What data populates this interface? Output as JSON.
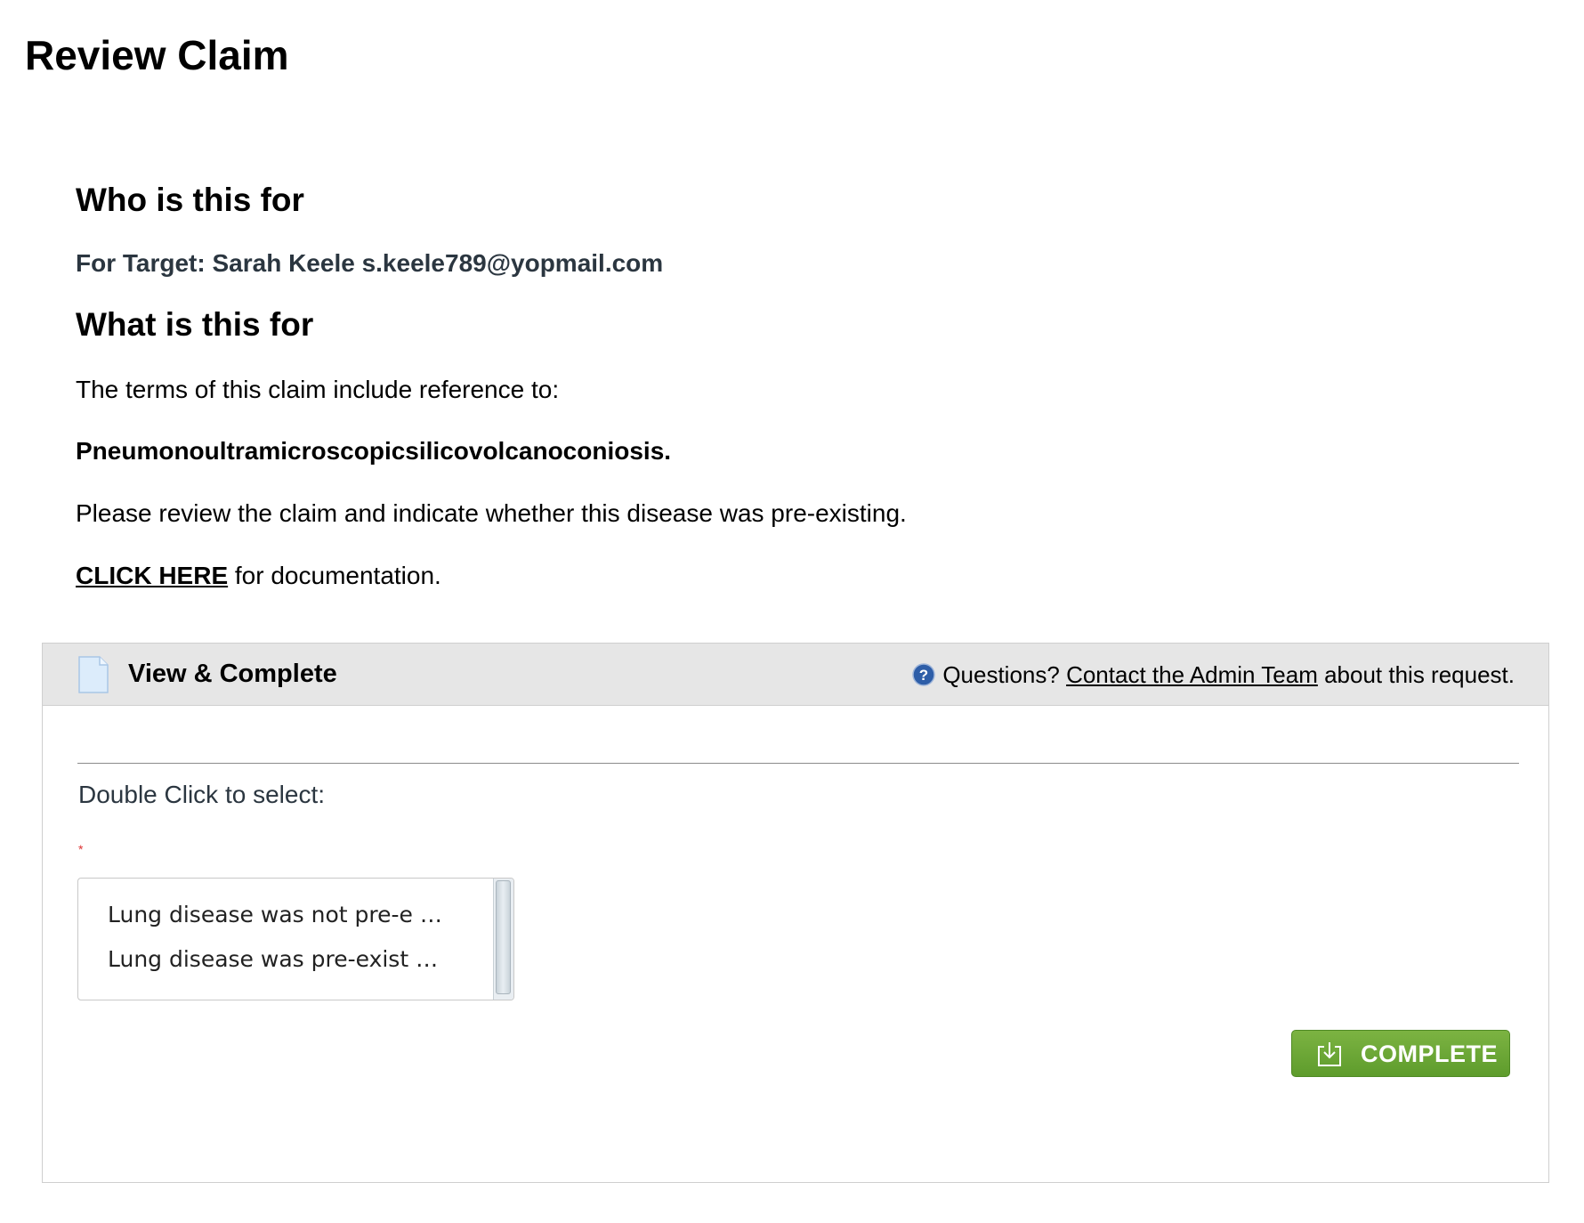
{
  "page": {
    "title": "Review Claim"
  },
  "who": {
    "heading": "Who is this for",
    "target_line": "For Target: Sarah Keele s.keele789@yopmail.com"
  },
  "what": {
    "heading": "What is this for",
    "intro": "The terms of this claim include reference to:",
    "disease": "Pneumonoultramicroscopicsilicovolcanoconiosis.",
    "instruction": "Please review the claim and indicate whether this disease was pre-existing.",
    "doc_link_label": "CLICK HERE",
    "doc_link_suffix": " for documentation."
  },
  "panel": {
    "title": "View & Complete",
    "help_prefix": "Questions? ",
    "help_link": "Contact the Admin Team",
    "help_suffix": " about this request.",
    "select_label": "Double Click to select:",
    "required_mark": "*",
    "options": [
      "Lung disease was not pre-e …",
      "Lung disease was pre-exist …"
    ],
    "complete_label": "COMPLETE"
  },
  "icons": {
    "document": "document-icon",
    "help": "question-circle-icon",
    "complete": "download-tray-icon"
  },
  "colors": {
    "complete_button": "#6aa336",
    "panel_header": "#e6e6e6",
    "help_icon": "#2e5ea8"
  }
}
